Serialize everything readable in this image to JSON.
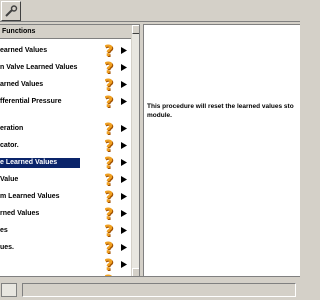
{
  "toolbar": {
    "tool_icon": "wrench-icon"
  },
  "panel": {
    "header": "Functions",
    "items": [
      {
        "label": "earned Values",
        "icon": "question-icon",
        "arrow": "play-arrow-icon"
      },
      {
        "label": "n Valve Learned Values",
        "icon": "question-icon",
        "arrow": "play-arrow-icon"
      },
      {
        "label": "arned Values",
        "icon": "question-icon",
        "arrow": "play-arrow-icon"
      },
      {
        "label": "fferential Pressure",
        "icon": "question-icon",
        "arrow": "play-arrow-icon"
      },
      {
        "label": "eration",
        "icon": "question-icon",
        "arrow": "play-arrow-icon"
      },
      {
        "label": "cator.",
        "icon": "question-icon",
        "arrow": "play-arrow-icon"
      },
      {
        "label": "e Learned Values",
        "icon": "question-icon",
        "arrow": "play-arrow-icon",
        "selected": true
      },
      {
        "label": "Value",
        "icon": "question-icon",
        "arrow": "play-arrow-icon"
      },
      {
        "label": "m Learned Values",
        "icon": "question-icon",
        "arrow": "play-arrow-icon"
      },
      {
        "label": "rned Values",
        "icon": "question-icon",
        "arrow": "play-arrow-icon"
      },
      {
        "label": "es",
        "icon": "question-icon",
        "arrow": "play-arrow-icon"
      },
      {
        "label": "ues.",
        "icon": "question-icon",
        "arrow": "play-arrow-icon"
      },
      {
        "label": "",
        "icon": "question-icon",
        "arrow": "play-arrow-icon"
      },
      {
        "label": "tion",
        "icon": "question-icon",
        "arrow": "play-arrow-icon"
      }
    ]
  },
  "info": {
    "text": "This procedure will reset the learned values sto module."
  },
  "colors": {
    "selection": "#0a246a",
    "question_icon": "#f0a020",
    "chrome": "#d4d0c8"
  }
}
